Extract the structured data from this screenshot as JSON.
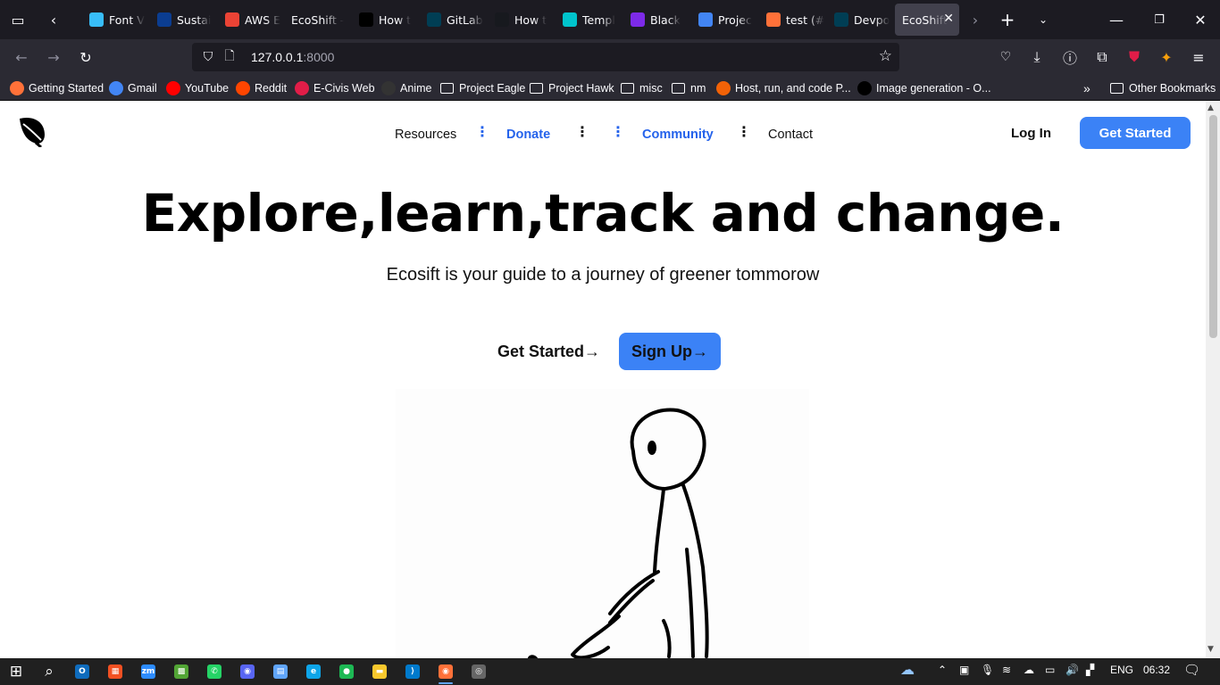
{
  "browser": {
    "tabs": [
      {
        "label": "Font V",
        "icon": "tailwind-icon",
        "color": "#38bdf8"
      },
      {
        "label": "Sustai",
        "icon": "nasa-icon",
        "color": "#0b3d91"
      },
      {
        "label": "AWS E",
        "icon": "gmail-icon",
        "color": "#ea4335"
      },
      {
        "label": "EcoShift -",
        "icon": "",
        "color": ""
      },
      {
        "label": "How t",
        "icon": "medium-icon",
        "color": "#000000"
      },
      {
        "label": "GitLab",
        "icon": "devpost-icon",
        "color": "#003e54"
      },
      {
        "label": "How t",
        "icon": "astro-icon",
        "color": "#17191e"
      },
      {
        "label": "Templ",
        "icon": "canva-icon",
        "color": "#00c4cc"
      },
      {
        "label": "Black",
        "icon": "canva-icon",
        "color": "#7d2ae8"
      },
      {
        "label": "Projec",
        "icon": "docs-icon",
        "color": "#4285f4"
      },
      {
        "label": "test (#",
        "icon": "firefox-icon",
        "color": "#ff7139"
      },
      {
        "label": "Devpo",
        "icon": "devpost-icon",
        "color": "#003e54"
      }
    ],
    "active_tab": {
      "label": "EcoShift"
    },
    "url": {
      "host": "127.0.0.1",
      "port": ":8000"
    },
    "bookmarks": [
      {
        "label": "Getting Started",
        "icon": "firefox-icon",
        "color": "#ff7139"
      },
      {
        "label": "Gmail",
        "icon": "google-icon",
        "color": "#4285f4"
      },
      {
        "label": "YouTube",
        "icon": "youtube-icon",
        "color": "#ff0000"
      },
      {
        "label": "Reddit",
        "icon": "reddit-icon",
        "color": "#ff4500"
      },
      {
        "label": "E-Civis Web",
        "icon": "ecivis-icon",
        "color": "#e11d48"
      },
      {
        "label": "Anime",
        "icon": "anime-icon",
        "color": "#333333"
      },
      {
        "label": "Project Eagle",
        "icon": "folder-icon",
        "color": ""
      },
      {
        "label": "Project Hawk",
        "icon": "folder-icon",
        "color": ""
      },
      {
        "label": "misc",
        "icon": "folder-icon",
        "color": ""
      },
      {
        "label": "nm",
        "icon": "folder-icon",
        "color": ""
      },
      {
        "label": "Host, run, and code P...",
        "icon": "replit-icon",
        "color": "#f26207"
      },
      {
        "label": "Image generation - O...",
        "icon": "openai-icon",
        "color": "#000000"
      }
    ],
    "other_bookmarks": "Other Bookmarks"
  },
  "site": {
    "nav": {
      "resources": "Resources",
      "donate": "Donate",
      "community": "Community",
      "contact": "Contact",
      "login": "Log In",
      "get_started": "Get Started"
    },
    "hero": {
      "title": "Explore,learn,track and change.",
      "subtitle": "Ecosift is your guide to a journey of greener tommorow",
      "cta_get_started": "Get Started→",
      "cta_signup": "Sign Up→"
    },
    "colors": {
      "accent": "#3b82f6",
      "link_blue": "#2563eb"
    }
  },
  "taskbar": {
    "apps": [
      "windows-start-icon",
      "search-icon",
      "outlook-icon",
      "store-icon",
      "zoom-icon",
      "minecraft-icon",
      "whatsapp-icon",
      "discord-icon",
      "notepad-icon",
      "edge-icon",
      "spotify-icon",
      "file-explorer-icon",
      "vscode-icon",
      "firefox-icon",
      "obs-icon"
    ],
    "language": "ENG",
    "time": "06:32"
  }
}
